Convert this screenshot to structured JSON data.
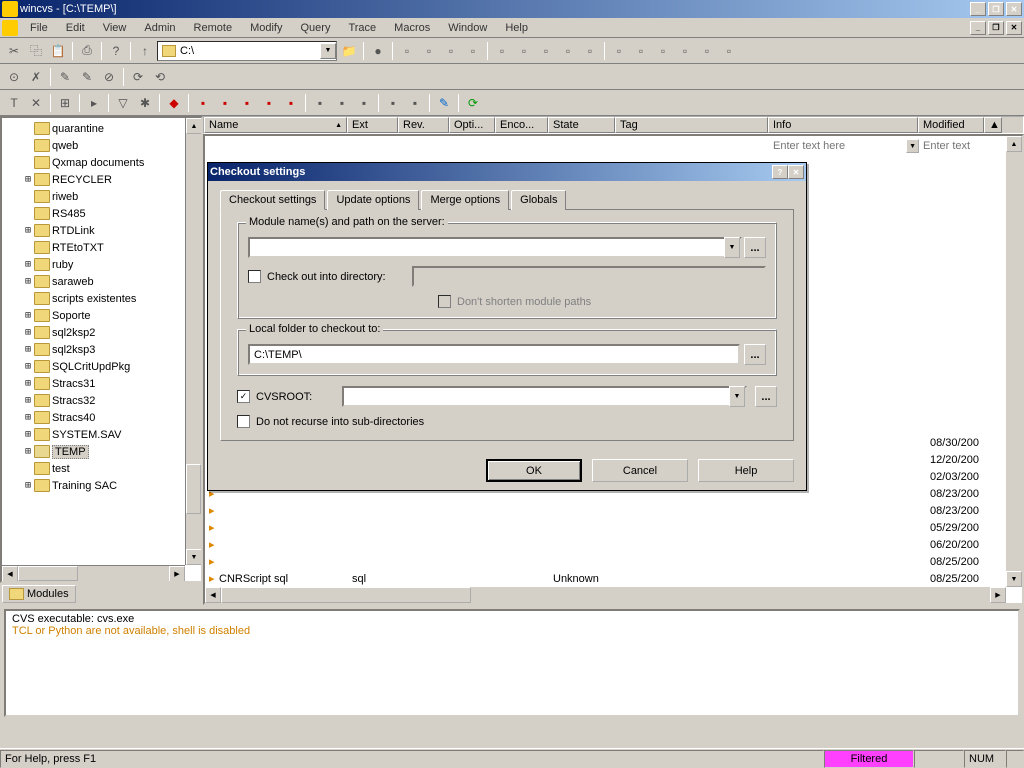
{
  "title": "wincvs - [C:\\TEMP\\]",
  "menu": [
    "File",
    "Edit",
    "View",
    "Admin",
    "Remote",
    "Modify",
    "Query",
    "Trace",
    "Macros",
    "Window",
    "Help"
  ],
  "path_combo": "C:\\",
  "tree": [
    {
      "exp": "",
      "label": "quarantine",
      "indent": 2
    },
    {
      "exp": "",
      "label": "qweb",
      "indent": 2
    },
    {
      "exp": "",
      "label": "Qxmap documents",
      "indent": 2
    },
    {
      "exp": "+",
      "label": "RECYCLER",
      "indent": 2
    },
    {
      "exp": "",
      "label": "riweb",
      "indent": 2
    },
    {
      "exp": "",
      "label": "RS485",
      "indent": 2
    },
    {
      "exp": "+",
      "label": "RTDLink",
      "indent": 2
    },
    {
      "exp": "",
      "label": "RTEtoTXT",
      "indent": 2
    },
    {
      "exp": "+",
      "label": "ruby",
      "indent": 2
    },
    {
      "exp": "+",
      "label": "saraweb",
      "indent": 2
    },
    {
      "exp": "",
      "label": "scripts existentes",
      "indent": 2
    },
    {
      "exp": "+",
      "label": "Soporte",
      "indent": 2
    },
    {
      "exp": "+",
      "label": "sql2ksp2",
      "indent": 2
    },
    {
      "exp": "+",
      "label": "sql2ksp3",
      "indent": 2
    },
    {
      "exp": "+",
      "label": "SQLCritUpdPkg",
      "indent": 2
    },
    {
      "exp": "+",
      "label": "Stracs31",
      "indent": 2
    },
    {
      "exp": "+",
      "label": "Stracs32",
      "indent": 2
    },
    {
      "exp": "+",
      "label": "Stracs40",
      "indent": 2
    },
    {
      "exp": "+",
      "label": "SYSTEM.SAV",
      "indent": 2
    },
    {
      "exp": "+",
      "label": "TEMP",
      "indent": 2,
      "sel": true,
      "open": true
    },
    {
      "exp": "",
      "label": "test",
      "indent": 2
    },
    {
      "exp": "+",
      "label": "Training SAC",
      "indent": 2
    }
  ],
  "modules_tab": "Modules",
  "columns": {
    "name": "Name",
    "ext": "Ext",
    "rev": "Rev.",
    "opti": "Opti...",
    "enco": "Enco...",
    "state": "State",
    "tag": "Tag",
    "info": "Info",
    "modified": "Modified"
  },
  "filter_placeholder": "Enter text here",
  "filter_placeholder2": "Enter text",
  "file_rows": [
    {
      "date": "08/30/200"
    },
    {
      "date": "12/20/200"
    },
    {
      "date": "02/03/200"
    },
    {
      "date": "08/23/200"
    },
    {
      "date": "08/23/200"
    },
    {
      "date": "05/29/200"
    },
    {
      "date": "06/20/200"
    },
    {
      "date": "08/25/200"
    }
  ],
  "last_row": {
    "name": "CNRScript sql",
    "ext": "sql",
    "state": "Unknown",
    "date": "08/25/200"
  },
  "console": {
    "line1": "CVS executable: cvs.exe",
    "line2": "TCL or Python are not available, shell is disabled"
  },
  "status": {
    "help": "For Help, press F1",
    "filtered": "Filtered",
    "num": "NUM"
  },
  "dialog": {
    "title": "Checkout settings",
    "tabs": [
      "Checkout settings",
      "Update options",
      "Merge options",
      "Globals"
    ],
    "group1": "Module name(s) and path on the server:",
    "check_into": "Check out into directory:",
    "dont_shorten": "Don't shorten module paths",
    "group2": "Local folder to checkout to:",
    "local_folder": "C:\\TEMP\\",
    "cvsroot": "CVSROOT:",
    "no_recurse": "Do not recurse into sub-directories",
    "ok": "OK",
    "cancel": "Cancel",
    "help": "Help",
    "browse": "..."
  }
}
